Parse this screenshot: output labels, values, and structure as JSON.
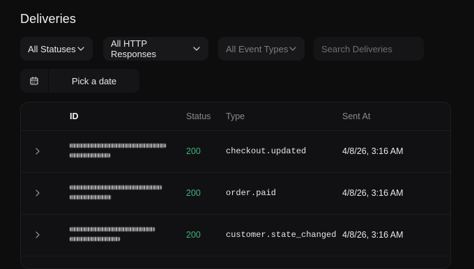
{
  "page": {
    "title": "Deliveries"
  },
  "filters": {
    "status": {
      "label": "All Statuses"
    },
    "http": {
      "label": "All HTTP Responses"
    },
    "event": {
      "label": "All Event Types"
    },
    "search_placeholder": "Search Deliveries",
    "date": {
      "label": "Pick a date",
      "icon": "calendar-icon"
    }
  },
  "table": {
    "headers": {
      "id": "ID",
      "status": "Status",
      "type": "Type",
      "sent_at": "Sent At"
    },
    "rows": [
      {
        "status": "200",
        "type": "checkout.updated",
        "sent_at": "4/8/26, 3:16 AM"
      },
      {
        "status": "200",
        "type": "order.paid",
        "sent_at": "4/8/26, 3:16 AM"
      },
      {
        "status": "200",
        "type": "customer.state_changed",
        "sent_at": "4/8/26, 3:16 AM"
      }
    ]
  },
  "colors": {
    "background": "#0d0d0e",
    "status_success": "#3fb37b",
    "muted": "#8b8b90"
  },
  "icons": {
    "dropdown": "chevron-down-icon",
    "row_expand": "chevron-right-icon"
  }
}
